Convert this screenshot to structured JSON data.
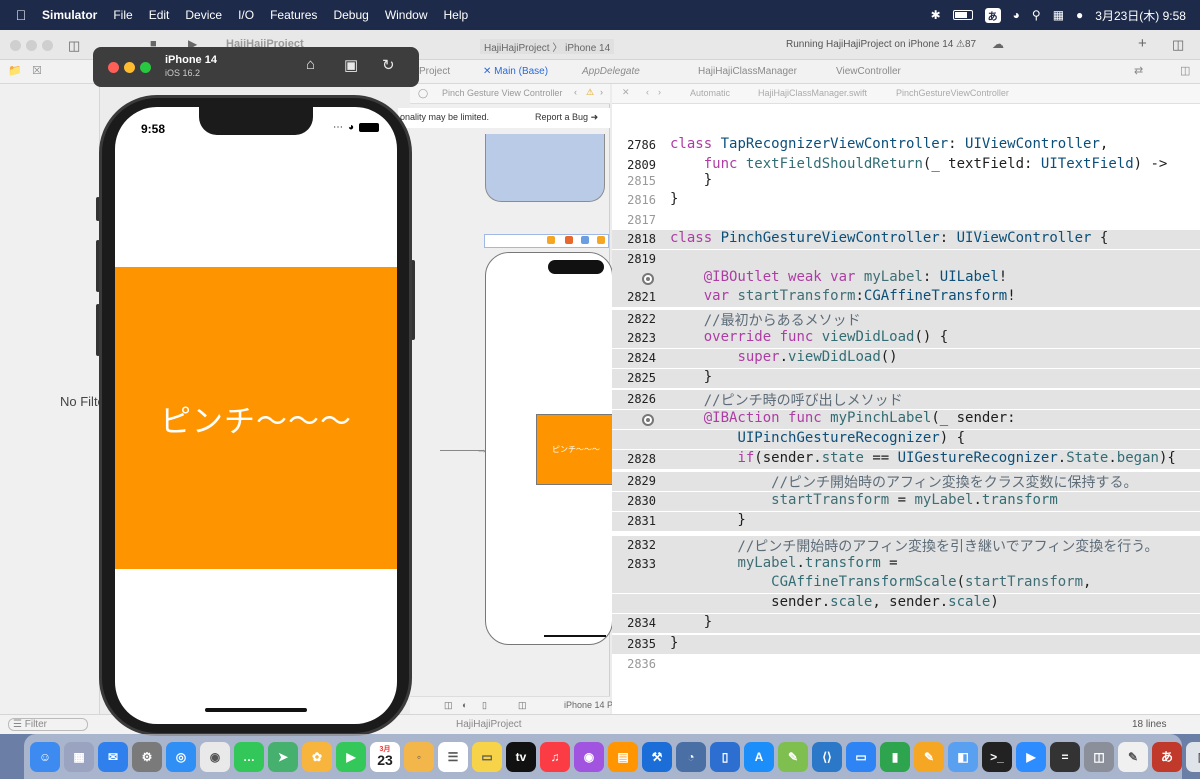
{
  "menubar": {
    "app_name": "Simulator",
    "items": [
      "File",
      "Edit",
      "Device",
      "I/O",
      "Features",
      "Debug",
      "Window",
      "Help"
    ],
    "input_method": "あ",
    "clock": "3月23日(木)  9:58"
  },
  "xcode": {
    "project_name": "HajiHajiProject",
    "scheme_path": "HajiHajiProject 〉 iPhone 14",
    "run_status": "Running HajiHajiProject on iPhone 14",
    "warning_count": "87",
    "tabs": [
      {
        "label": "Project"
      },
      {
        "label": "Main (Base)"
      },
      {
        "label": "AppDelegate"
      },
      {
        "label": "HajiHajiClassManager"
      },
      {
        "label": "ViewController"
      }
    ],
    "ib_jump": "Pinch Gesture View Controller",
    "ib_warning": "onality may be limited.",
    "report_bug": "Report a Bug",
    "ib_label_text": "ピンチ〜〜〜",
    "navigator_text": "No Filte",
    "editor_jump": {
      "automatic": "Automatic",
      "file": "HajiHajiClassManager.swift",
      "symbol": "PinchGestureViewController"
    },
    "filter_placeholder": "Filter",
    "device_label": "iPhone 14 P",
    "status_path": "HajiHajiProject",
    "line_count": "18 lines"
  },
  "code": [
    {
      "n": "2786",
      "t": "class TapRecognizerViewController: UIViewController,"
    },
    {
      "n": "2809",
      "t": "    func textFieldShouldReturn(_ textField: UITextField) ->"
    },
    {
      "n": "2815",
      "t": "    }"
    },
    {
      "n": "2816",
      "t": "}"
    },
    {
      "n": "2817",
      "t": ""
    },
    {
      "n": "2818",
      "t": "class PinchGestureViewController: UIViewController {"
    },
    {
      "n": "2819",
      "t": ""
    },
    {
      "n": "",
      "t": "    @IBOutlet weak var myLabel: UILabel!"
    },
    {
      "n": "2821",
      "t": "    var startTransform:CGAffineTransform!"
    },
    {
      "n": "2822",
      "t": "    //最初からあるメソッド"
    },
    {
      "n": "2823",
      "t": "    override func viewDidLoad() {"
    },
    {
      "n": "2824",
      "t": "        super.viewDidLoad()"
    },
    {
      "n": "2825",
      "t": "    }"
    },
    {
      "n": "2826",
      "t": "    //ピンチ時の呼び出しメソッド"
    },
    {
      "n": "",
      "t": "    @IBAction func myPinchLabel(_ sender:"
    },
    {
      "n": "",
      "t": "        UIPinchGestureRecognizer) {"
    },
    {
      "n": "2828",
      "t": "        if(sender.state == UIGestureRecognizer.State.began){"
    },
    {
      "n": "2829",
      "t": "            //ピンチ開始時のアフィン変換をクラス変数に保持する。"
    },
    {
      "n": "2830",
      "t": "            startTransform = myLabel.transform"
    },
    {
      "n": "2831",
      "t": "        }"
    },
    {
      "n": "2832",
      "t": "        //ピンチ開始時のアフィン変換を引き継いでアフィン変換を行う。"
    },
    {
      "n": "2833",
      "t": "        myLabel.transform ="
    },
    {
      "n": "",
      "t": "            CGAffineTransformScale(startTransform,"
    },
    {
      "n": "",
      "t": "            sender.scale, sender.scale)"
    },
    {
      "n": "2834",
      "t": "    }"
    },
    {
      "n": "2835",
      "t": "}"
    },
    {
      "n": "2836",
      "t": ""
    }
  ],
  "simulator": {
    "device_name": "iPhone 14",
    "os_version": "iOS 16.2",
    "time": "9:58",
    "label_text": "ピンチ〜〜〜",
    "label_color": "#FE9500"
  },
  "dock": {
    "calendar_month": "3月",
    "calendar_day": "23",
    "appletv_label": "tv",
    "input_method": "あ",
    "apps": [
      "finder",
      "launchpad",
      "mail",
      "system-settings",
      "safari",
      "chrome",
      "messages",
      "maps",
      "photos",
      "facetime",
      "calendar",
      "notes-app",
      "reminders",
      "notes",
      "apple-tv",
      "music",
      "podcasts",
      "books",
      "xcode",
      "instruments",
      "simulator",
      "app-store",
      "pencil-app",
      "vscode",
      "keynote",
      "numbers",
      "pages",
      "preview",
      "terminal",
      "zoom",
      "calculator",
      "disk",
      "textedit",
      "input-method",
      "trash"
    ]
  }
}
